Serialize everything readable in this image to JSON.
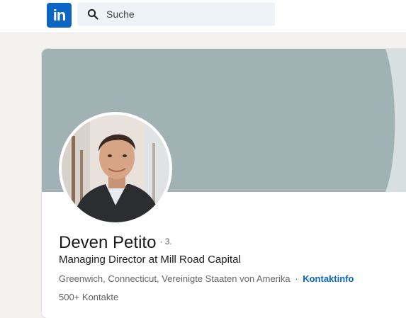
{
  "brand": {
    "logo_text": "in",
    "color": "#0a66c2"
  },
  "search": {
    "placeholder": "Suche",
    "icon": "search-icon"
  },
  "profile": {
    "name": "Deven Petito",
    "degree": "· 3.",
    "headline": "Managing Director at Mill Road Capital",
    "location": "Greenwich, Connecticut, Vereinigte Staaten von Amerika",
    "separator": "·",
    "contact_info_label": "Kontaktinfo",
    "connections": "500+ Kontakte",
    "cover_color": "#a0b2b4"
  }
}
